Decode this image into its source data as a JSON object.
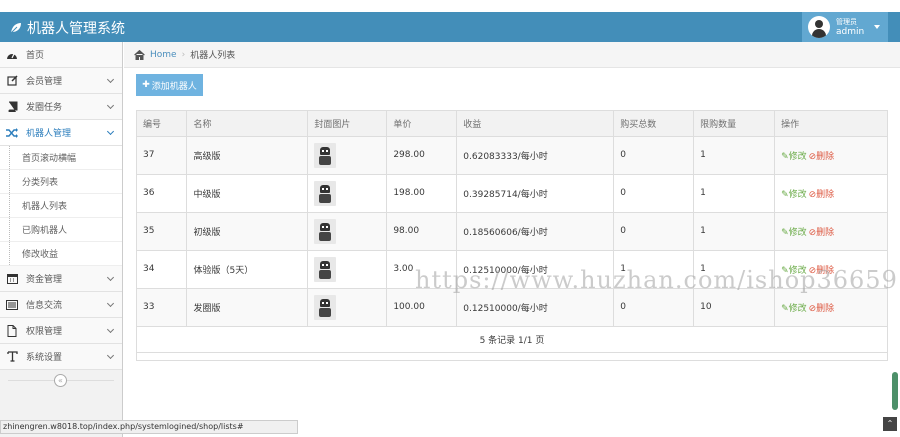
{
  "header": {
    "title": "机器人管理系统",
    "user_role": "管理员",
    "user_name": "admin"
  },
  "sidebar": {
    "items": [
      {
        "label": "首页",
        "icon": "dashboard-icon"
      },
      {
        "label": "会员管理",
        "icon": "edit-icon"
      },
      {
        "label": "发圈任务",
        "icon": "book-icon"
      },
      {
        "label": "机器人管理",
        "icon": "shuffle-icon"
      },
      {
        "label": "资金管理",
        "icon": "calendar-icon"
      },
      {
        "label": "信息交流",
        "icon": "list-icon"
      },
      {
        "label": "权限管理",
        "icon": "file-icon"
      },
      {
        "label": "系统设置",
        "icon": "text-icon"
      }
    ],
    "sub_items": [
      "首页滚动横幅",
      "分类列表",
      "机器人列表",
      "已购机器人",
      "修改收益"
    ],
    "collapse_glyph": "«"
  },
  "breadcrumb": {
    "home": "Home",
    "current": "机器人列表"
  },
  "toolbar": {
    "add_label": "添加机器人"
  },
  "table": {
    "headers": [
      "编号",
      "名称",
      "封面图片",
      "单价",
      "收益",
      "购买总数",
      "限购数量",
      "操作"
    ],
    "rows": [
      {
        "id": "37",
        "name": "高级版",
        "price": "298.00",
        "income": "0.62083333/每小时",
        "bought": "0",
        "limit": "1"
      },
      {
        "id": "36",
        "name": "中级版",
        "price": "198.00",
        "income": "0.39285714/每小时",
        "bought": "0",
        "limit": "1"
      },
      {
        "id": "35",
        "name": "初级版",
        "price": "98.00",
        "income": "0.18560606/每小时",
        "bought": "0",
        "limit": "1"
      },
      {
        "id": "34",
        "name": "体验版（5天）",
        "price": "3.00",
        "income": "0.12510000/每小时",
        "bought": "1",
        "limit": "1"
      },
      {
        "id": "33",
        "name": "发圈版",
        "price": "100.00",
        "income": "0.12510000/每小时",
        "bought": "0",
        "limit": "10"
      }
    ],
    "edit_label": "修改",
    "delete_label": "删除",
    "pager": "5 条记录 1/1 页"
  },
  "watermark": "https://www.huzhan.com/ishop36659",
  "status_url": "zhinengren.w8018.top/index.php/systemlogined/shop/lists#",
  "colors": {
    "header": "#438eb9",
    "accent": "#2b7dbc",
    "button": "#6fb3e0",
    "edit": "#69aa46",
    "delete": "#dd5a43"
  }
}
